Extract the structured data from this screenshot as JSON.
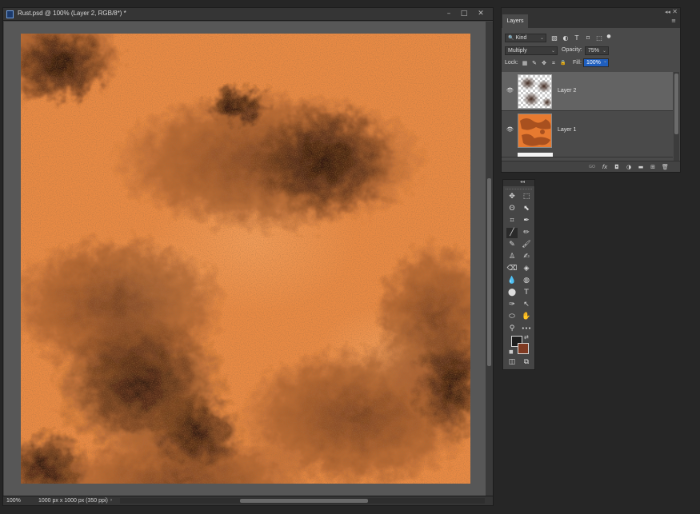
{
  "document": {
    "title": "Rust.psd @ 100% (Layer 2, RGB/8*) *",
    "zoom": "100%",
    "info": "1000 px x 1000 px (350 ppi)",
    "info_arrow": "›",
    "window_buttons": {
      "minimize": "–",
      "maximize": "□",
      "close": "✕"
    }
  },
  "layers_panel": {
    "tab_label": "Layers",
    "collapse_icon": "◂◂",
    "close_icon": "✕",
    "menu_icon": "≡",
    "filter": {
      "search_glyph": "🔍",
      "label": "Kind",
      "caret": "⌄"
    },
    "filter_icons": [
      "▧",
      "◐",
      "T",
      "⌑",
      "⬚",
      "●"
    ],
    "blend_mode": "Multiply",
    "opacity_label": "Opacity:",
    "opacity_value": "75%",
    "lock_label": "Lock:",
    "lock_icons": [
      "▦",
      "✎",
      "✥",
      "⌗",
      "🔒"
    ],
    "fill_label": "Fill:",
    "fill_value": "100%",
    "layers": [
      {
        "name": "Layer 2",
        "visible": true,
        "selected": true,
        "eye": "👁"
      },
      {
        "name": "Layer 1",
        "visible": true,
        "selected": false,
        "eye": "👁"
      }
    ],
    "footer_icons": [
      "GO",
      "fx",
      "◘",
      "◑",
      "▬",
      "⊞",
      "🗑"
    ]
  },
  "tools_panel": {
    "collapse_icon": "◂◂",
    "tools": [
      [
        "✥",
        "⬚"
      ],
      [
        "ʘ",
        "⬉"
      ],
      [
        "⌗",
        "✒"
      ],
      [
        "╱",
        "✏"
      ],
      [
        "✎",
        "🖌"
      ],
      [
        "♙",
        "✍"
      ],
      [
        "⌫",
        "◈"
      ],
      [
        "💧",
        "◍"
      ],
      [
        "⬤",
        "T"
      ],
      [
        "✑",
        "↖"
      ],
      [
        "⬭",
        "✋"
      ],
      [
        "⚲",
        "•••"
      ]
    ],
    "swap_glyph": "⇄",
    "default_colors_glyph": "◼",
    "bottom_tools": [
      "◫",
      "⧉"
    ],
    "foreground_color": "#1e1e1e",
    "background_color": "#7f3a22"
  },
  "colors": {
    "canvas_base": "#e5823a",
    "rust_dark": "#3a1e10",
    "rust_mid": "#8a4a24"
  }
}
